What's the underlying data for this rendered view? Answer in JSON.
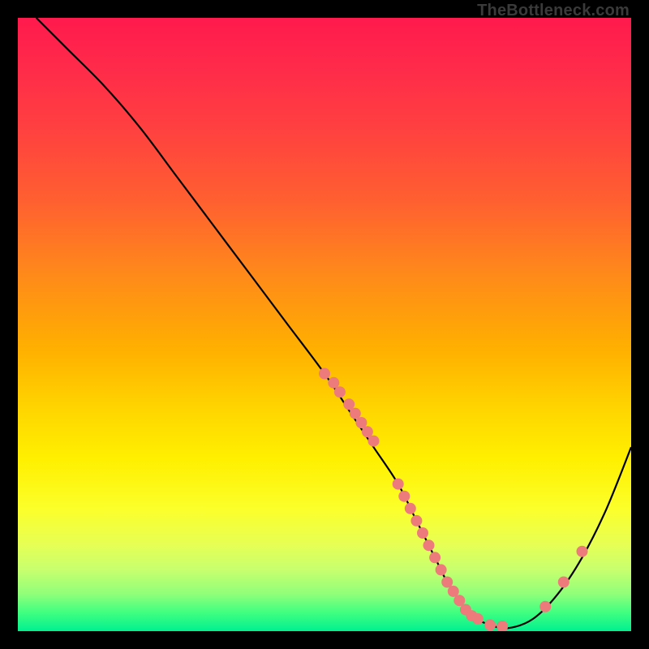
{
  "attribution": "TheBottleneck.com",
  "chart_data": {
    "type": "line",
    "title": "",
    "xlabel": "",
    "ylabel": "",
    "xlim": [
      0,
      100
    ],
    "ylim": [
      0,
      100
    ],
    "grid": false,
    "series": [
      {
        "name": "curve",
        "x_percent": [
          3,
          8,
          14,
          20,
          26,
          32,
          38,
          44,
          50,
          54,
          58,
          62,
          65,
          68,
          70,
          72,
          74,
          77,
          80,
          84,
          88,
          92,
          96,
          100
        ],
        "y_percent": [
          100,
          95,
          89,
          82,
          74,
          66,
          58,
          50,
          42,
          36,
          30,
          24,
          18,
          12,
          8,
          5,
          2.5,
          1,
          0.5,
          2,
          6,
          12,
          20,
          30
        ]
      }
    ],
    "markers": {
      "name": "data-points",
      "x_percent": [
        50,
        51.5,
        52.5,
        54,
        55,
        56,
        57,
        58,
        62,
        63,
        64,
        65,
        66,
        67,
        68,
        69,
        70,
        71,
        72,
        73,
        74,
        75,
        77,
        79,
        86,
        89,
        92
      ],
      "y_percent": [
        42,
        40.5,
        39,
        37,
        35.5,
        34,
        32.5,
        31,
        24,
        22,
        20,
        18,
        16,
        14,
        12,
        10,
        8,
        6.5,
        5,
        3.5,
        2.5,
        2,
        1,
        0.8,
        4,
        8,
        13
      ]
    },
    "marker_color": "#ed7b7b",
    "line_color": "#000000"
  }
}
